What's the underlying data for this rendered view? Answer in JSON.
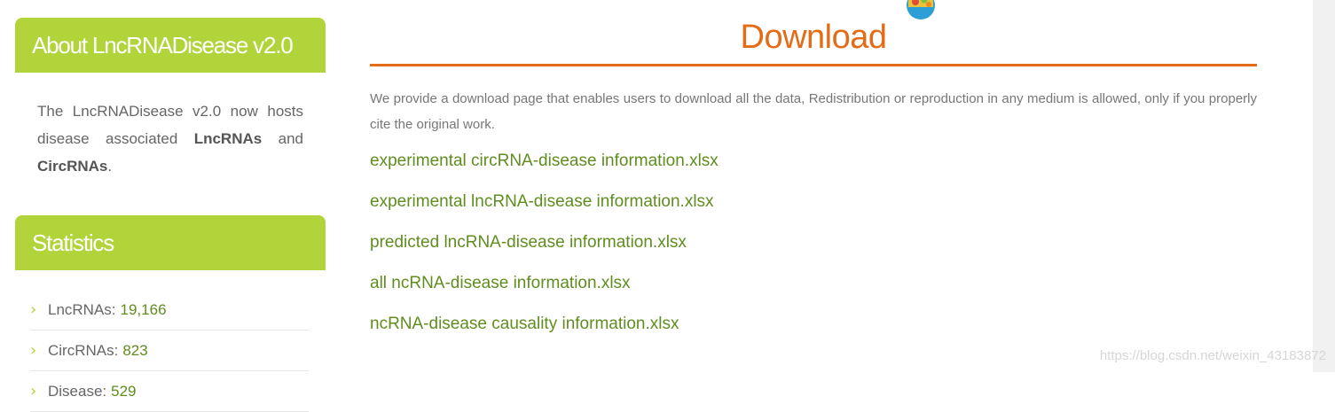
{
  "sidebar": {
    "about": {
      "title": "About LncRNADisease v2.0",
      "text_before": "The LncRNADisease v2.0 now hosts disease associated ",
      "bold1": "LncRNAs",
      "text_middle": " and ",
      "bold2": "CircRNAs",
      "text_after": "."
    },
    "statistics": {
      "title": "Statistics",
      "items": [
        {
          "label": "LncRNAs:",
          "value": "19,166"
        },
        {
          "label": "CircRNAs:",
          "value": "823"
        },
        {
          "label": "Disease:",
          "value": "529"
        }
      ]
    }
  },
  "main": {
    "title": "Download",
    "intro": "We provide a download page that enables users to download all the data, Redistribution or reproduction in any medium is allowed, only if you properly cite the original work.",
    "downloads": [
      "experimental circRNA-disease information.xlsx",
      "experimental lncRNA-disease information.xlsx",
      "predicted lncRNA-disease information.xlsx",
      "all ncRNA-disease information.xlsx",
      "ncRNA-disease causality information.xlsx"
    ]
  },
  "watermark": "https://blog.csdn.net/weixin_43183872",
  "colors": {
    "accent_green": "#b1d43a",
    "link_green": "#5f8d1f",
    "title_orange": "#e46c17"
  }
}
